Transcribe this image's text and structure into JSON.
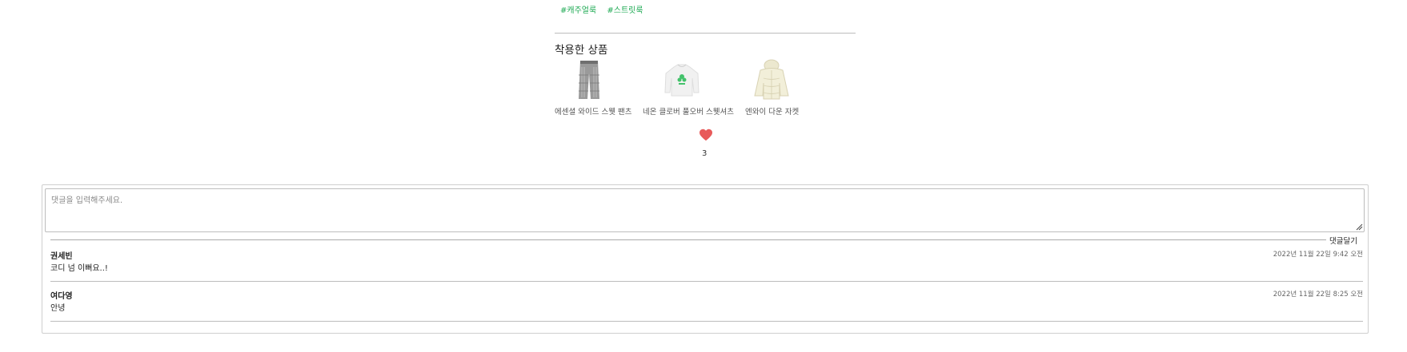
{
  "tags": [
    "#캐주얼룩",
    "#스트릿룩"
  ],
  "worn_products": {
    "title": "착용한 상품",
    "items": [
      {
        "name": "에센셜 와이드 스웻 팬츠",
        "icon": "pants-icon"
      },
      {
        "name": "네온 클로버 풀오버 스웻셔츠",
        "icon": "sweatshirt-icon"
      },
      {
        "name": "엔와이 다운 자켓",
        "icon": "down-jacket-icon"
      }
    ]
  },
  "likes": {
    "count": "3",
    "icon": "heart-icon",
    "color": "#e85a5a"
  },
  "comment_form": {
    "placeholder": "댓글을 입력해주세요.",
    "submit_label": "댓글달기"
  },
  "comments": [
    {
      "author": "권세빈",
      "text": "코디 넘 이뻐요..!",
      "time": "2022년 11월 22일 9:42 오전"
    },
    {
      "author": "여다영",
      "text": "안녕",
      "time": "2022년 11월 22일 8:25 오전"
    }
  ],
  "colors": {
    "tag": "#1faa54",
    "heart": "#e85a5a",
    "border": "#cfcfcf"
  }
}
